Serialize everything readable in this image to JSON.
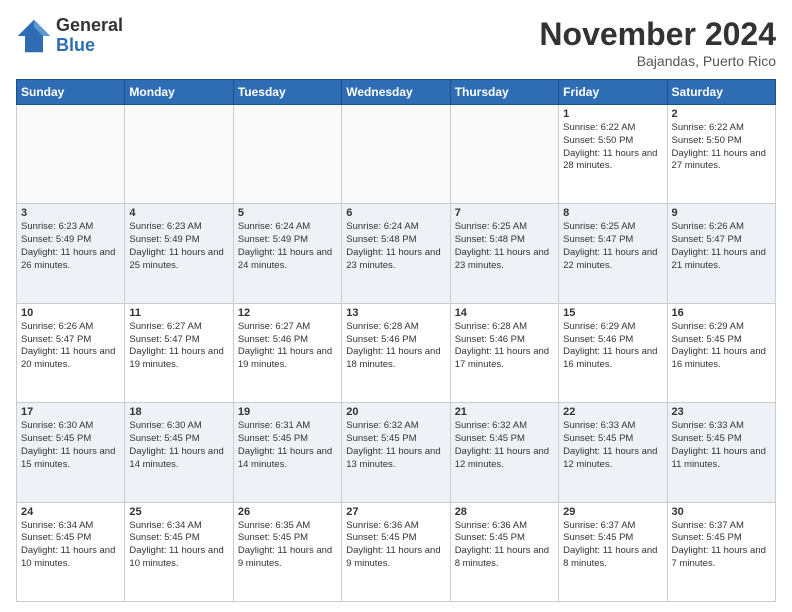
{
  "logo": {
    "general": "General",
    "blue": "Blue"
  },
  "header": {
    "month": "November 2024",
    "location": "Bajandas, Puerto Rico"
  },
  "weekdays": [
    "Sunday",
    "Monday",
    "Tuesday",
    "Wednesday",
    "Thursday",
    "Friday",
    "Saturday"
  ],
  "weeks": [
    [
      {
        "day": "",
        "info": ""
      },
      {
        "day": "",
        "info": ""
      },
      {
        "day": "",
        "info": ""
      },
      {
        "day": "",
        "info": ""
      },
      {
        "day": "",
        "info": ""
      },
      {
        "day": "1",
        "info": "Sunrise: 6:22 AM\nSunset: 5:50 PM\nDaylight: 11 hours\nand 28 minutes."
      },
      {
        "day": "2",
        "info": "Sunrise: 6:22 AM\nSunset: 5:50 PM\nDaylight: 11 hours\nand 27 minutes."
      }
    ],
    [
      {
        "day": "3",
        "info": "Sunrise: 6:23 AM\nSunset: 5:49 PM\nDaylight: 11 hours\nand 26 minutes."
      },
      {
        "day": "4",
        "info": "Sunrise: 6:23 AM\nSunset: 5:49 PM\nDaylight: 11 hours\nand 25 minutes."
      },
      {
        "day": "5",
        "info": "Sunrise: 6:24 AM\nSunset: 5:49 PM\nDaylight: 11 hours\nand 24 minutes."
      },
      {
        "day": "6",
        "info": "Sunrise: 6:24 AM\nSunset: 5:48 PM\nDaylight: 11 hours\nand 23 minutes."
      },
      {
        "day": "7",
        "info": "Sunrise: 6:25 AM\nSunset: 5:48 PM\nDaylight: 11 hours\nand 23 minutes."
      },
      {
        "day": "8",
        "info": "Sunrise: 6:25 AM\nSunset: 5:47 PM\nDaylight: 11 hours\nand 22 minutes."
      },
      {
        "day": "9",
        "info": "Sunrise: 6:26 AM\nSunset: 5:47 PM\nDaylight: 11 hours\nand 21 minutes."
      }
    ],
    [
      {
        "day": "10",
        "info": "Sunrise: 6:26 AM\nSunset: 5:47 PM\nDaylight: 11 hours\nand 20 minutes."
      },
      {
        "day": "11",
        "info": "Sunrise: 6:27 AM\nSunset: 5:47 PM\nDaylight: 11 hours\nand 19 minutes."
      },
      {
        "day": "12",
        "info": "Sunrise: 6:27 AM\nSunset: 5:46 PM\nDaylight: 11 hours\nand 19 minutes."
      },
      {
        "day": "13",
        "info": "Sunrise: 6:28 AM\nSunset: 5:46 PM\nDaylight: 11 hours\nand 18 minutes."
      },
      {
        "day": "14",
        "info": "Sunrise: 6:28 AM\nSunset: 5:46 PM\nDaylight: 11 hours\nand 17 minutes."
      },
      {
        "day": "15",
        "info": "Sunrise: 6:29 AM\nSunset: 5:46 PM\nDaylight: 11 hours\nand 16 minutes."
      },
      {
        "day": "16",
        "info": "Sunrise: 6:29 AM\nSunset: 5:45 PM\nDaylight: 11 hours\nand 16 minutes."
      }
    ],
    [
      {
        "day": "17",
        "info": "Sunrise: 6:30 AM\nSunset: 5:45 PM\nDaylight: 11 hours\nand 15 minutes."
      },
      {
        "day": "18",
        "info": "Sunrise: 6:30 AM\nSunset: 5:45 PM\nDaylight: 11 hours\nand 14 minutes."
      },
      {
        "day": "19",
        "info": "Sunrise: 6:31 AM\nSunset: 5:45 PM\nDaylight: 11 hours\nand 14 minutes."
      },
      {
        "day": "20",
        "info": "Sunrise: 6:32 AM\nSunset: 5:45 PM\nDaylight: 11 hours\nand 13 minutes."
      },
      {
        "day": "21",
        "info": "Sunrise: 6:32 AM\nSunset: 5:45 PM\nDaylight: 11 hours\nand 12 minutes."
      },
      {
        "day": "22",
        "info": "Sunrise: 6:33 AM\nSunset: 5:45 PM\nDaylight: 11 hours\nand 12 minutes."
      },
      {
        "day": "23",
        "info": "Sunrise: 6:33 AM\nSunset: 5:45 PM\nDaylight: 11 hours\nand 11 minutes."
      }
    ],
    [
      {
        "day": "24",
        "info": "Sunrise: 6:34 AM\nSunset: 5:45 PM\nDaylight: 11 hours\nand 10 minutes."
      },
      {
        "day": "25",
        "info": "Sunrise: 6:34 AM\nSunset: 5:45 PM\nDaylight: 11 hours\nand 10 minutes."
      },
      {
        "day": "26",
        "info": "Sunrise: 6:35 AM\nSunset: 5:45 PM\nDaylight: 11 hours\nand 9 minutes."
      },
      {
        "day": "27",
        "info": "Sunrise: 6:36 AM\nSunset: 5:45 PM\nDaylight: 11 hours\nand 9 minutes."
      },
      {
        "day": "28",
        "info": "Sunrise: 6:36 AM\nSunset: 5:45 PM\nDaylight: 11 hours\nand 8 minutes."
      },
      {
        "day": "29",
        "info": "Sunrise: 6:37 AM\nSunset: 5:45 PM\nDaylight: 11 hours\nand 8 minutes."
      },
      {
        "day": "30",
        "info": "Sunrise: 6:37 AM\nSunset: 5:45 PM\nDaylight: 11 hours\nand 7 minutes."
      }
    ]
  ]
}
